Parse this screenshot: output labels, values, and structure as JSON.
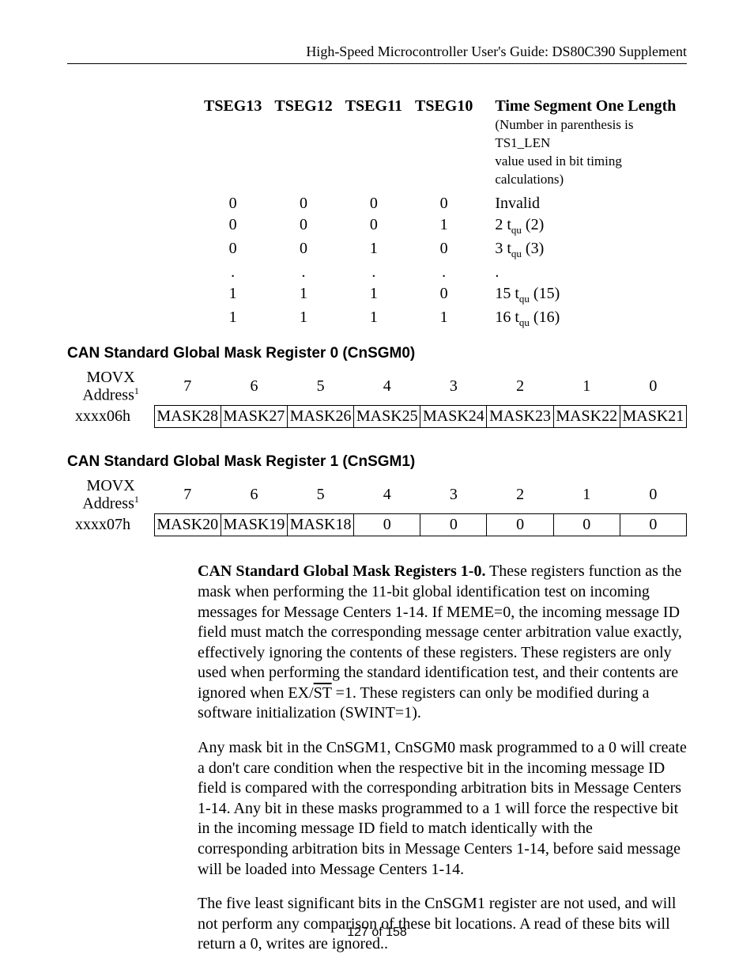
{
  "header": "High-Speed Microcontroller User's Guide: DS80C390 Supplement",
  "tseg": {
    "cols": [
      "TSEG13",
      "TSEG12",
      "TSEG11",
      "TSEG10"
    ],
    "desc_header": "Time Segment One Length",
    "desc_sub1": "(Number in parenthesis is TS1_LEN",
    "desc_sub2": "value used in bit timing calculations)",
    "rows": [
      {
        "b": [
          "0",
          "0",
          "0",
          "0"
        ],
        "d": "Invalid"
      },
      {
        "b": [
          "0",
          "0",
          "0",
          "1"
        ],
        "d": "2 t",
        "sub": "qu",
        "tail": " (2)"
      },
      {
        "b": [
          "0",
          "0",
          "1",
          "0"
        ],
        "d": "3 t",
        "sub": "qu",
        "tail": " (3)"
      },
      {
        "b": [
          ".",
          ".",
          ".",
          "."
        ],
        "d": "."
      },
      {
        "b": [
          "1",
          "1",
          "1",
          "0"
        ],
        "d": "15 t",
        "sub": "qu",
        "tail": " (15)"
      },
      {
        "b": [
          "1",
          "1",
          "1",
          "1"
        ],
        "d": "16 t",
        "sub": "qu",
        "tail": " (16)"
      }
    ]
  },
  "sgm0": {
    "title": "CAN Standard Global Mask Register 0 (CnSGM0)",
    "movx": "MOVX",
    "addr_label": "Address",
    "addr_sup": "1",
    "bits": [
      "7",
      "6",
      "5",
      "4",
      "3",
      "2",
      "1",
      "0"
    ],
    "address": "xxxx06h",
    "cells": [
      "MASK28",
      "MASK27",
      "MASK26",
      "MASK25",
      "MASK24",
      "MASK23",
      "MASK22",
      "MASK21"
    ]
  },
  "sgm1": {
    "title": "CAN Standard Global Mask Register 1 (CnSGM1)",
    "movx": "MOVX",
    "addr_label": "Address",
    "addr_sup": "1",
    "bits": [
      "7",
      "6",
      "5",
      "4",
      "3",
      "2",
      "1",
      "0"
    ],
    "address": "xxxx07h",
    "cells": [
      "MASK20",
      "MASK19",
      "MASK18",
      "0",
      "0",
      "0",
      "0",
      "0"
    ]
  },
  "body": {
    "p1_lead": "CAN Standard Global Mask Registers 1-0.",
    "p1_a": " These registers function as the mask when performing the 11-bit global identification test on incoming messages for Message Centers 1-14. If MEME=0, the incoming message ID field must match the corresponding message center arbitration value exactly, effectively ignoring the contents of these registers. These registers are only used when performing the standard identification test, and their contents are ignored when EX/",
    "p1_over": "ST",
    "p1_b": " =1. These registers can only be modified during a software initialization (SWINT=1).",
    "p2": "Any mask bit in the CnSGM1, CnSGM0 mask programmed to a 0 will create a don't care condition when the respective bit in the incoming message ID field is compared with the corresponding arbitration bits in Message Centers 1-14. Any bit in these masks programmed to a 1 will force the respective bit in the incoming message ID field to match identically with the corresponding arbitration bits in Message Centers 1-14, before said message will be loaded into Message Centers 1-14.",
    "p3": "The five least significant bits in the CnSGM1 register are not used, and will not perform any comparison of these bit locations. A read of these bits will return a 0, writes are ignored.."
  },
  "footer": "127 of 158"
}
